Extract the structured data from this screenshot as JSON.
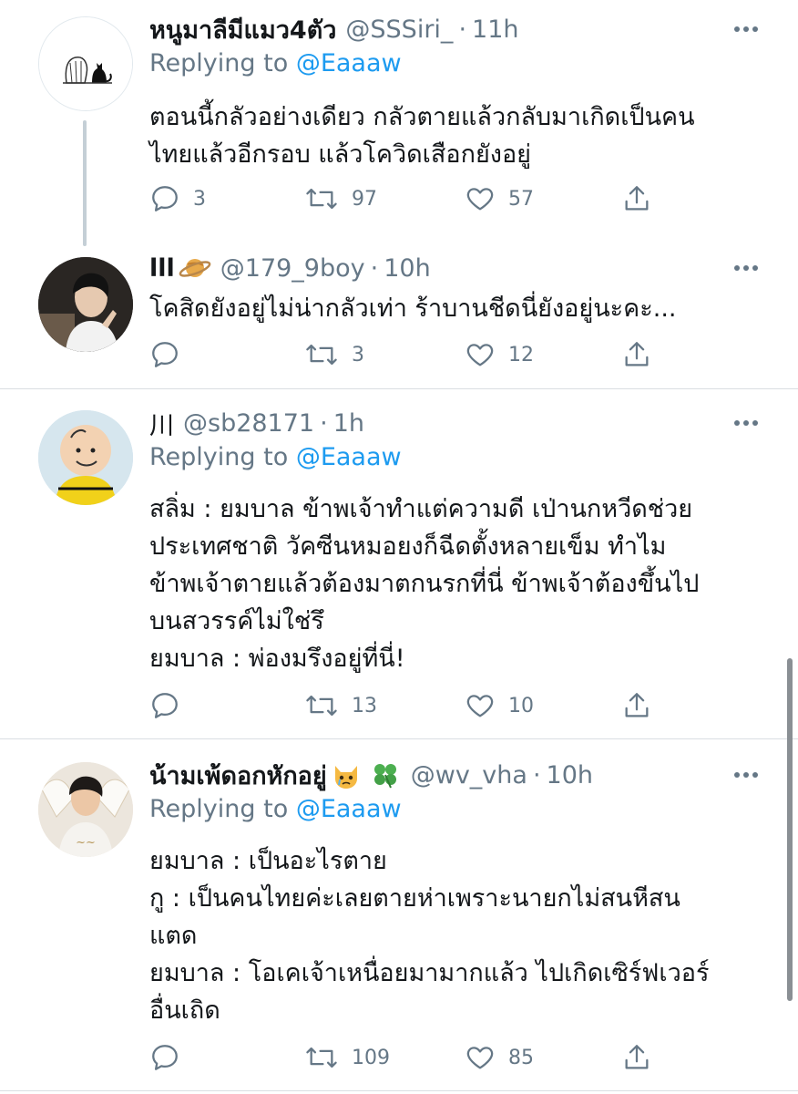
{
  "tweets": [
    {
      "name": "หนูมาลีมีแมว4ตัว",
      "handle": "@SSSiri_",
      "dot": "·",
      "time": "11h",
      "replying_prefix": "Replying to",
      "replying_to": "@Eaaaw",
      "lines": [
        "ตอนนี้กลัวอย่างเดียว กลัวตายแล้วกลับมาเกิดเป็นคน",
        "ไทยแล้วอีกรอบ แล้วโควิดเสือกยังอยู่"
      ],
      "replies": "3",
      "retweets": "97",
      "likes": "57"
    },
    {
      "name": "lll",
      "handle": "@179_9boy",
      "dot": "·",
      "time": "10h",
      "lines": [
        "โคสิดยังอยู่ไม่น่ากลัวเท่า ร้าบานชีดนี่ยังอยู่นะคะ..."
      ],
      "replies": "",
      "retweets": "3",
      "likes": "12"
    },
    {
      "name": "川",
      "handle": "@sb28171",
      "dot": "·",
      "time": "1h",
      "replying_prefix": "Replying to",
      "replying_to": "@Eaaaw",
      "lines": [
        "สลิ่ม : ยมบาล ข้าพเจ้าทำแต่ความดี เป่านกหวีดช่วย",
        "ประเทศชาติ วัคซีนหมอยงก็ฉีดตั้งหลายเข็ม ทำไม",
        "ข้าพเจ้าตายแล้วต้องมาตกนรกที่นี่ ข้าพเจ้าต้องขึ้นไป",
        "บนสวรรค์ไม่ใช่รึ",
        "ยมบาล : พ่องมรึงอยู่ที่นี่!"
      ],
      "replies": "",
      "retweets": "13",
      "likes": "10"
    },
    {
      "name": "น้ามเพ้ดอกหักอยู่",
      "handle": "@wv_vha",
      "dot": "·",
      "time": "10h",
      "replying_prefix": "Replying to",
      "replying_to": "@Eaaaw",
      "lines": [
        "ยมบาล : เป็นอะไรตาย",
        "กู : เป็นคนไทยค่ะเลยตายห่าเพราะนายกไม่สนหีสน",
        "แตด",
        "ยมบาล : โอเคเจ้าเหนื่อยมามากแล้ว ไปเกิดเซิร์ฟเวอร์",
        "อื่นเถิด"
      ],
      "replies": "",
      "retweets": "109",
      "likes": "85"
    }
  ],
  "icons": {
    "reply": "reply-icon",
    "retweet": "retweet-icon",
    "like": "heart-icon",
    "share": "share-icon",
    "more": "more-icon"
  },
  "colors": {
    "text": "#14171a",
    "secondary": "#657786",
    "link": "#1d9bf0",
    "divider": "#d9dee2"
  }
}
